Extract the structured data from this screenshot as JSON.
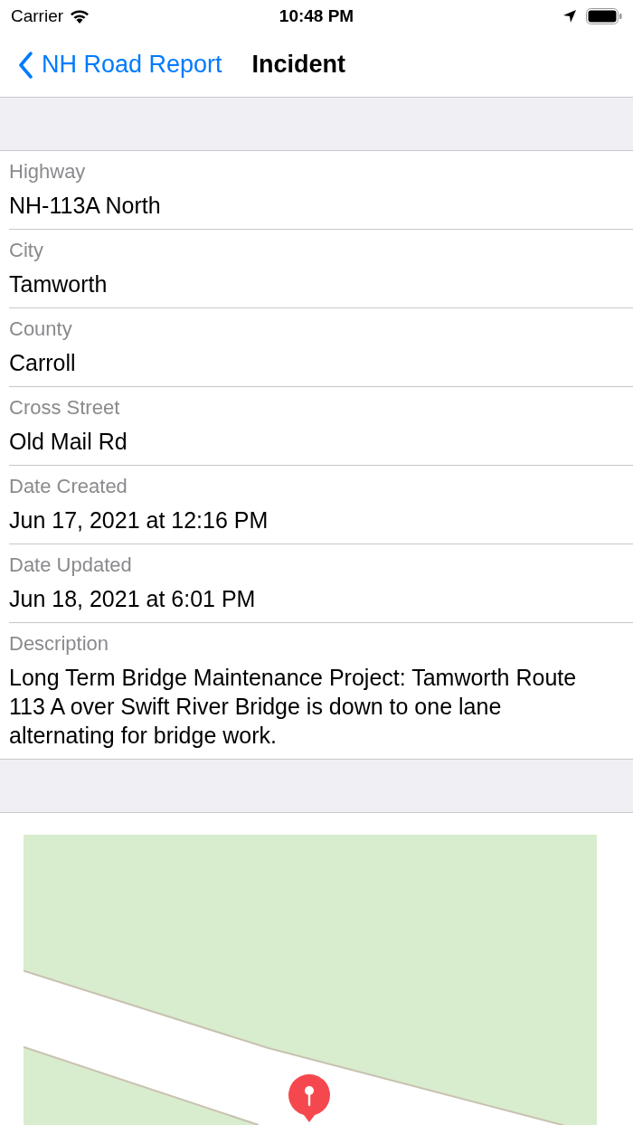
{
  "status_bar": {
    "carrier": "Carrier",
    "time": "10:48 PM"
  },
  "nav": {
    "back": "NH Road Report",
    "title": "Incident"
  },
  "fields": [
    {
      "label": "Highway",
      "value": "NH-113A North"
    },
    {
      "label": "City",
      "value": "Tamworth"
    },
    {
      "label": "County",
      "value": "Carroll"
    },
    {
      "label": "Cross Street",
      "value": "Old Mail Rd"
    },
    {
      "label": "Date Created",
      "value": "Jun 17, 2021 at 12:16 PM"
    },
    {
      "label": "Date Updated",
      "value": "Jun 18, 2021 at 6:01 PM"
    },
    {
      "label": "Description",
      "value": "Long Term Bridge Maintenance Project: Tamworth Route 113 A over Swift River Bridge is down to one lane alternating for bridge work."
    }
  ]
}
